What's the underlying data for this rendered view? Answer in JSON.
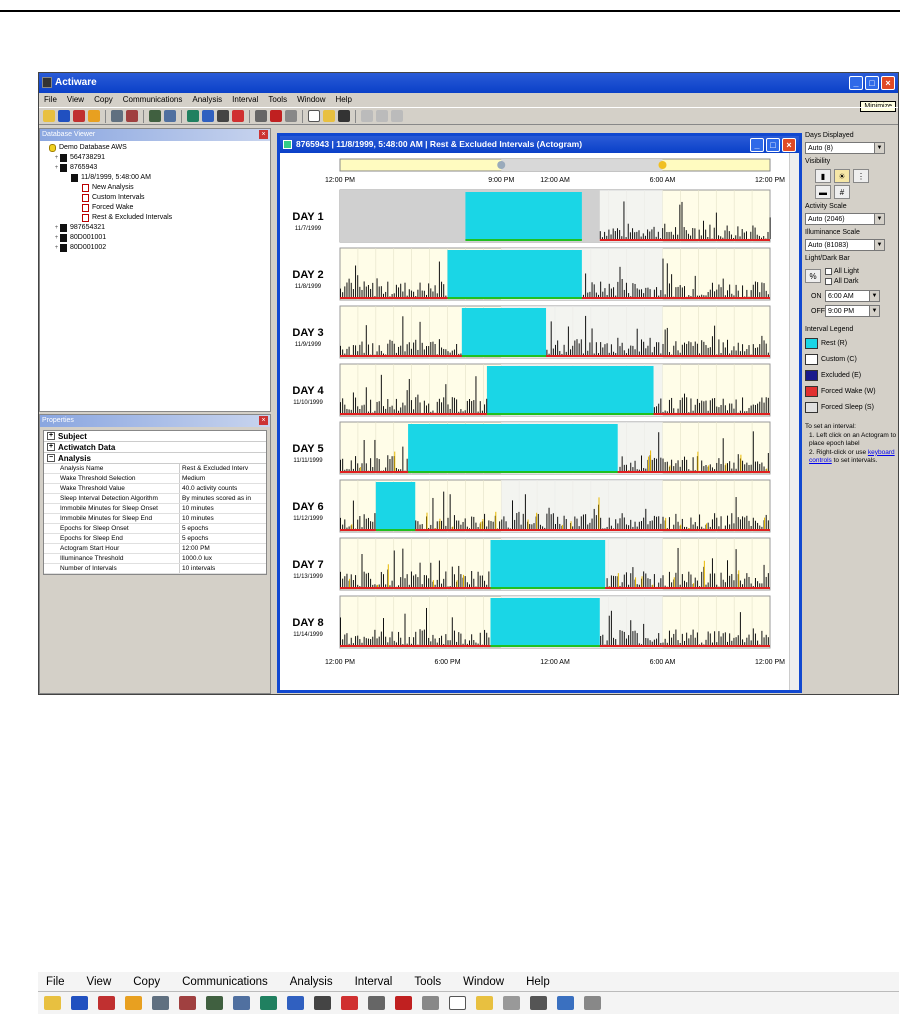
{
  "app": {
    "title": "Actiware",
    "tooltip": "Minimize"
  },
  "menu": [
    "File",
    "View",
    "Copy",
    "Communications",
    "Analysis",
    "Interval",
    "Tools",
    "Window",
    "Help"
  ],
  "database_viewer": {
    "title": "Database Viewer",
    "tree": [
      {
        "label": "Demo Database AWS",
        "type": "db",
        "level": 0
      },
      {
        "label": "564738291",
        "type": "subject",
        "level": 1
      },
      {
        "label": "8765943",
        "type": "subject",
        "level": 1
      },
      {
        "label": "11/8/1999, 5:48:00 AM",
        "type": "subject",
        "level": 2
      },
      {
        "label": "New Analysis",
        "type": "analysis",
        "level": 3
      },
      {
        "label": "Custom Intervals",
        "type": "analysis",
        "level": 3
      },
      {
        "label": "Forced Wake",
        "type": "analysis",
        "level": 3
      },
      {
        "label": "Rest & Excluded Intervals",
        "type": "analysis",
        "level": 3
      },
      {
        "label": "987654321",
        "type": "subject",
        "level": 1
      },
      {
        "label": "80D001001",
        "type": "subject",
        "level": 1
      },
      {
        "label": "80D001002",
        "type": "subject",
        "level": 1
      }
    ]
  },
  "properties": {
    "title": "Properties",
    "sections": [
      "Subject",
      "Actiwatch Data",
      "Analysis"
    ],
    "rows": [
      [
        "Analysis Name",
        "Rest & Excluded Interv"
      ],
      [
        "Wake Threshold Selection",
        "Medium"
      ],
      [
        "Wake Threshold Value",
        "40.0 activity counts"
      ],
      [
        "Sleep Interval Detection Algorithm",
        "By minutes scored as in"
      ],
      [
        "Immobile Minutes for Sleep Onset",
        "10 minutes"
      ],
      [
        "Immobile Minutes for Sleep End",
        "10 minutes"
      ],
      [
        "Epochs for Sleep Onset",
        "5 epochs"
      ],
      [
        "Epochs for Sleep End",
        "5 epochs"
      ],
      [
        "Actogram Start Hour",
        "12:00 PM"
      ],
      [
        "Illuminance Threshold",
        "1000.0 lux"
      ],
      [
        "Number of Intervals",
        "10 intervals"
      ]
    ]
  },
  "actogram": {
    "title": "8765943 | 11/8/1999, 5:48:00 AM | Rest & Excluded Intervals (Actogram)",
    "top_ticks": [
      "12:00 PM",
      "9:00 PM",
      "12:00 AM",
      "6:00 AM",
      "12:00 PM"
    ],
    "bottom_ticks": [
      "12:00 PM",
      "6:00 PM",
      "12:00 AM",
      "6:00 AM",
      "12:00 PM"
    ],
    "days": [
      {
        "label": "DAY 1",
        "date": "11/7/1999"
      },
      {
        "label": "DAY 2",
        "date": "11/8/1999"
      },
      {
        "label": "DAY 3",
        "date": "11/9/1999"
      },
      {
        "label": "DAY 4",
        "date": "11/10/1999"
      },
      {
        "label": "DAY 5",
        "date": "11/11/1999"
      },
      {
        "label": "DAY 6",
        "date": "11/12/1999"
      },
      {
        "label": "DAY 7",
        "date": "11/13/1999"
      },
      {
        "label": "DAY 8",
        "date": "11/14/1999"
      }
    ]
  },
  "side_panel": {
    "days_displayed_label": "Days Displayed",
    "days_displayed_value": "Auto (8)",
    "visibility_label": "Visibility",
    "activity_scale_label": "Activity Scale",
    "activity_scale_value": "Auto (2046)",
    "illuminance_scale_label": "Illuminance Scale",
    "illuminance_scale_value": "Auto (81083)",
    "lightdark_label": "Light/Dark Bar",
    "all_light": "All Light",
    "all_dark": "All Dark",
    "on_label": "ON",
    "on_value": "6:00 AM",
    "off_label": "OFF",
    "off_value": "9:00 PM",
    "legend_label": "Interval Legend",
    "legend": [
      {
        "name": "Rest (R)",
        "color": "#1ad6e6"
      },
      {
        "name": "Custom (C)",
        "color": "#ffffff"
      },
      {
        "name": "Excluded (E)",
        "color": "#1a1a8c"
      },
      {
        "name": "Forced Wake (W)",
        "color": "#e03030"
      },
      {
        "name": "Forced Sleep (S)",
        "color": "#e0e0e0"
      }
    ],
    "note_title": "To set an interval:",
    "note_1": "1. Left click on an Actogram to place epoch label",
    "note_2a": "2. Right-click or use",
    "note_link": "keyboard controls",
    "note_2b": "to set intervals."
  },
  "colors": {
    "rest": "#1ad6e6",
    "excluded_gray": "#d0d0d0",
    "plot_bg": "#fffde8",
    "activity": "#111111",
    "light": "#e8b800",
    "wake_line": "#e02020",
    "sleep_line": "#20c020"
  }
}
